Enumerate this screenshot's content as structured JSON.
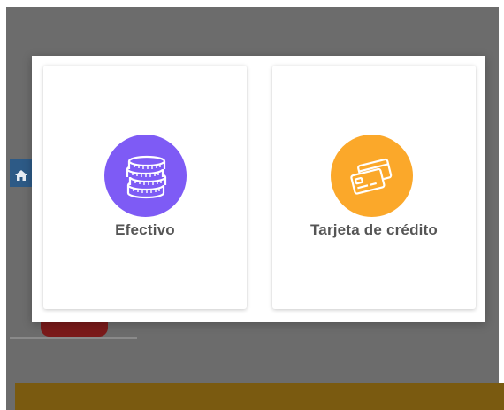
{
  "background": {
    "home_icon": "home-icon"
  },
  "modal": {
    "options": [
      {
        "label": "Efectivo",
        "icon": "coins-icon",
        "color": "#7e5bf5"
      },
      {
        "label": "Tarjeta de crédito",
        "icon": "credit-cards-icon",
        "color": "#fba82a"
      }
    ]
  }
}
